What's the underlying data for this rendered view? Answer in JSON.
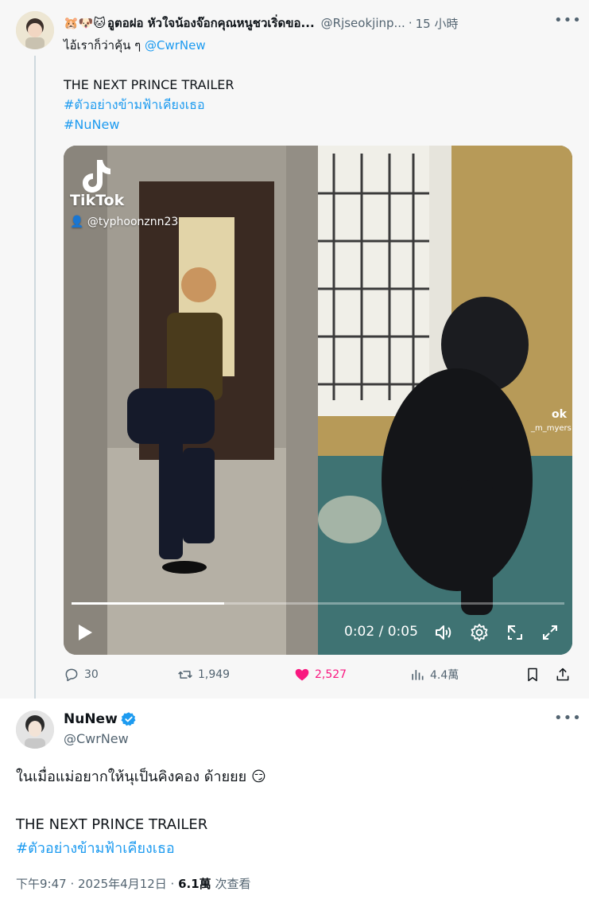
{
  "reply": {
    "emoji_prefix": "🐹🐶🐱",
    "display_name": "อูตอฝอ หัวใจน้องจ๊อกคุณหนูชวเริ่ดขอ...",
    "handle": "@Rjseokjinp...",
    "dot": "·",
    "time": "15 小時",
    "replying_text": "ไอ้เราก็ว่าคุ้น ๆ",
    "replying_mention": "@CwrNew",
    "body_lines": [
      "THE NEXT PRINCE TRAILER"
    ],
    "hashtags": [
      "#ตัวอย่างข้ามฟ้าเคียงเธอ",
      "#NuNew"
    ],
    "video": {
      "tiktok_label": "TikTok",
      "tiktok_user": "👤 @typhoonznn23",
      "right_watermark": "ok",
      "right_watermark_sub": "_m_myers",
      "timecode": "0:02 / 0:05",
      "progress": 0.31
    },
    "actions": {
      "reply_count": "30",
      "retweet_count": "1,949",
      "like_count": "2,527",
      "view_count": "4.4萬"
    }
  },
  "main": {
    "display_name": "NuNew",
    "handle": "@CwrNew",
    "body_line1": "ในเมื่อแม่อยากให้นุเป็นคิงคอง ด้ายยย 😏",
    "body_line2": "THE NEXT PRINCE TRAILER",
    "hashtag": "#ตัวอย่างข้ามฟ้าเคียงเธอ",
    "time": "下午9:47 · 2025年4月12日 · ",
    "views_count": "6.1萬",
    "views_label": " 次查看"
  },
  "colors": {
    "accent": "#1d9bf0",
    "like": "#f91880",
    "muted": "#536471"
  }
}
